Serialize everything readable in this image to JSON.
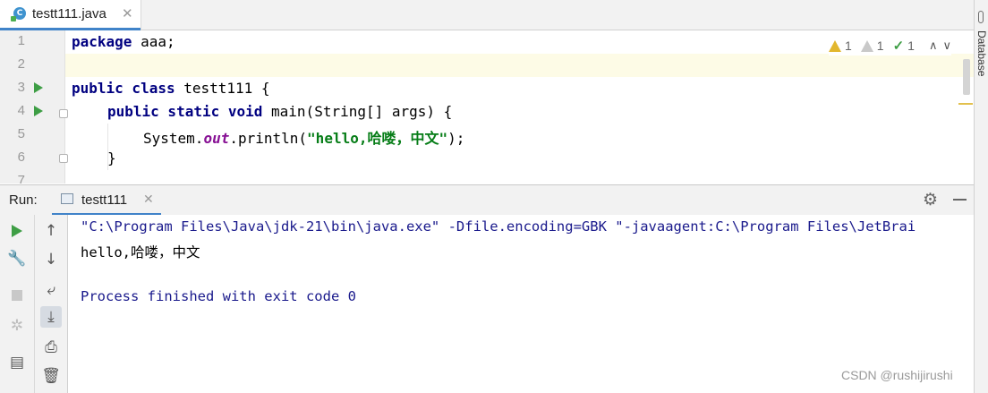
{
  "editor_tab": {
    "title": "testt111.java",
    "close": "✕",
    "icon": "java-class-icon"
  },
  "right_sidebar": {
    "label": "Database",
    "icon": "database-icon"
  },
  "inspections": {
    "warnings": "1",
    "weak_warnings": "1",
    "typos": "1",
    "up": "∧",
    "down": "∨"
  },
  "gutter": {
    "line_numbers": [
      "1",
      "2",
      "3",
      "4",
      "5",
      "6",
      "7"
    ]
  },
  "code": {
    "l1_kw": "package",
    "l1_rest": " aaa;",
    "l3_kw": "public class",
    "l3_rest": " testt111 {",
    "l4_kw": "public static void",
    "l4_rest": " main(String[] args) {",
    "l5_pre": "System.",
    "l5_field": "out",
    "l5_mid": ".println(",
    "l5_str": "\"hello,哈喽，中文\"",
    "l5_end": ");",
    "l6": "}"
  },
  "run_panel": {
    "label": "Run:",
    "tab_title": "testt111",
    "tab_close": "✕",
    "settings_icon": "gear-icon",
    "hide_icon": "minimize-icon"
  },
  "console": {
    "command": "\"C:\\Program Files\\Java\\jdk-21\\bin\\java.exe\" -Dfile.encoding=GBK \"-javaagent:C:\\Program Files\\JetBrai",
    "output": "hello,哈喽，中文",
    "exit": "Process finished with exit code 0"
  },
  "watermark": "CSDN @rushijirushi"
}
